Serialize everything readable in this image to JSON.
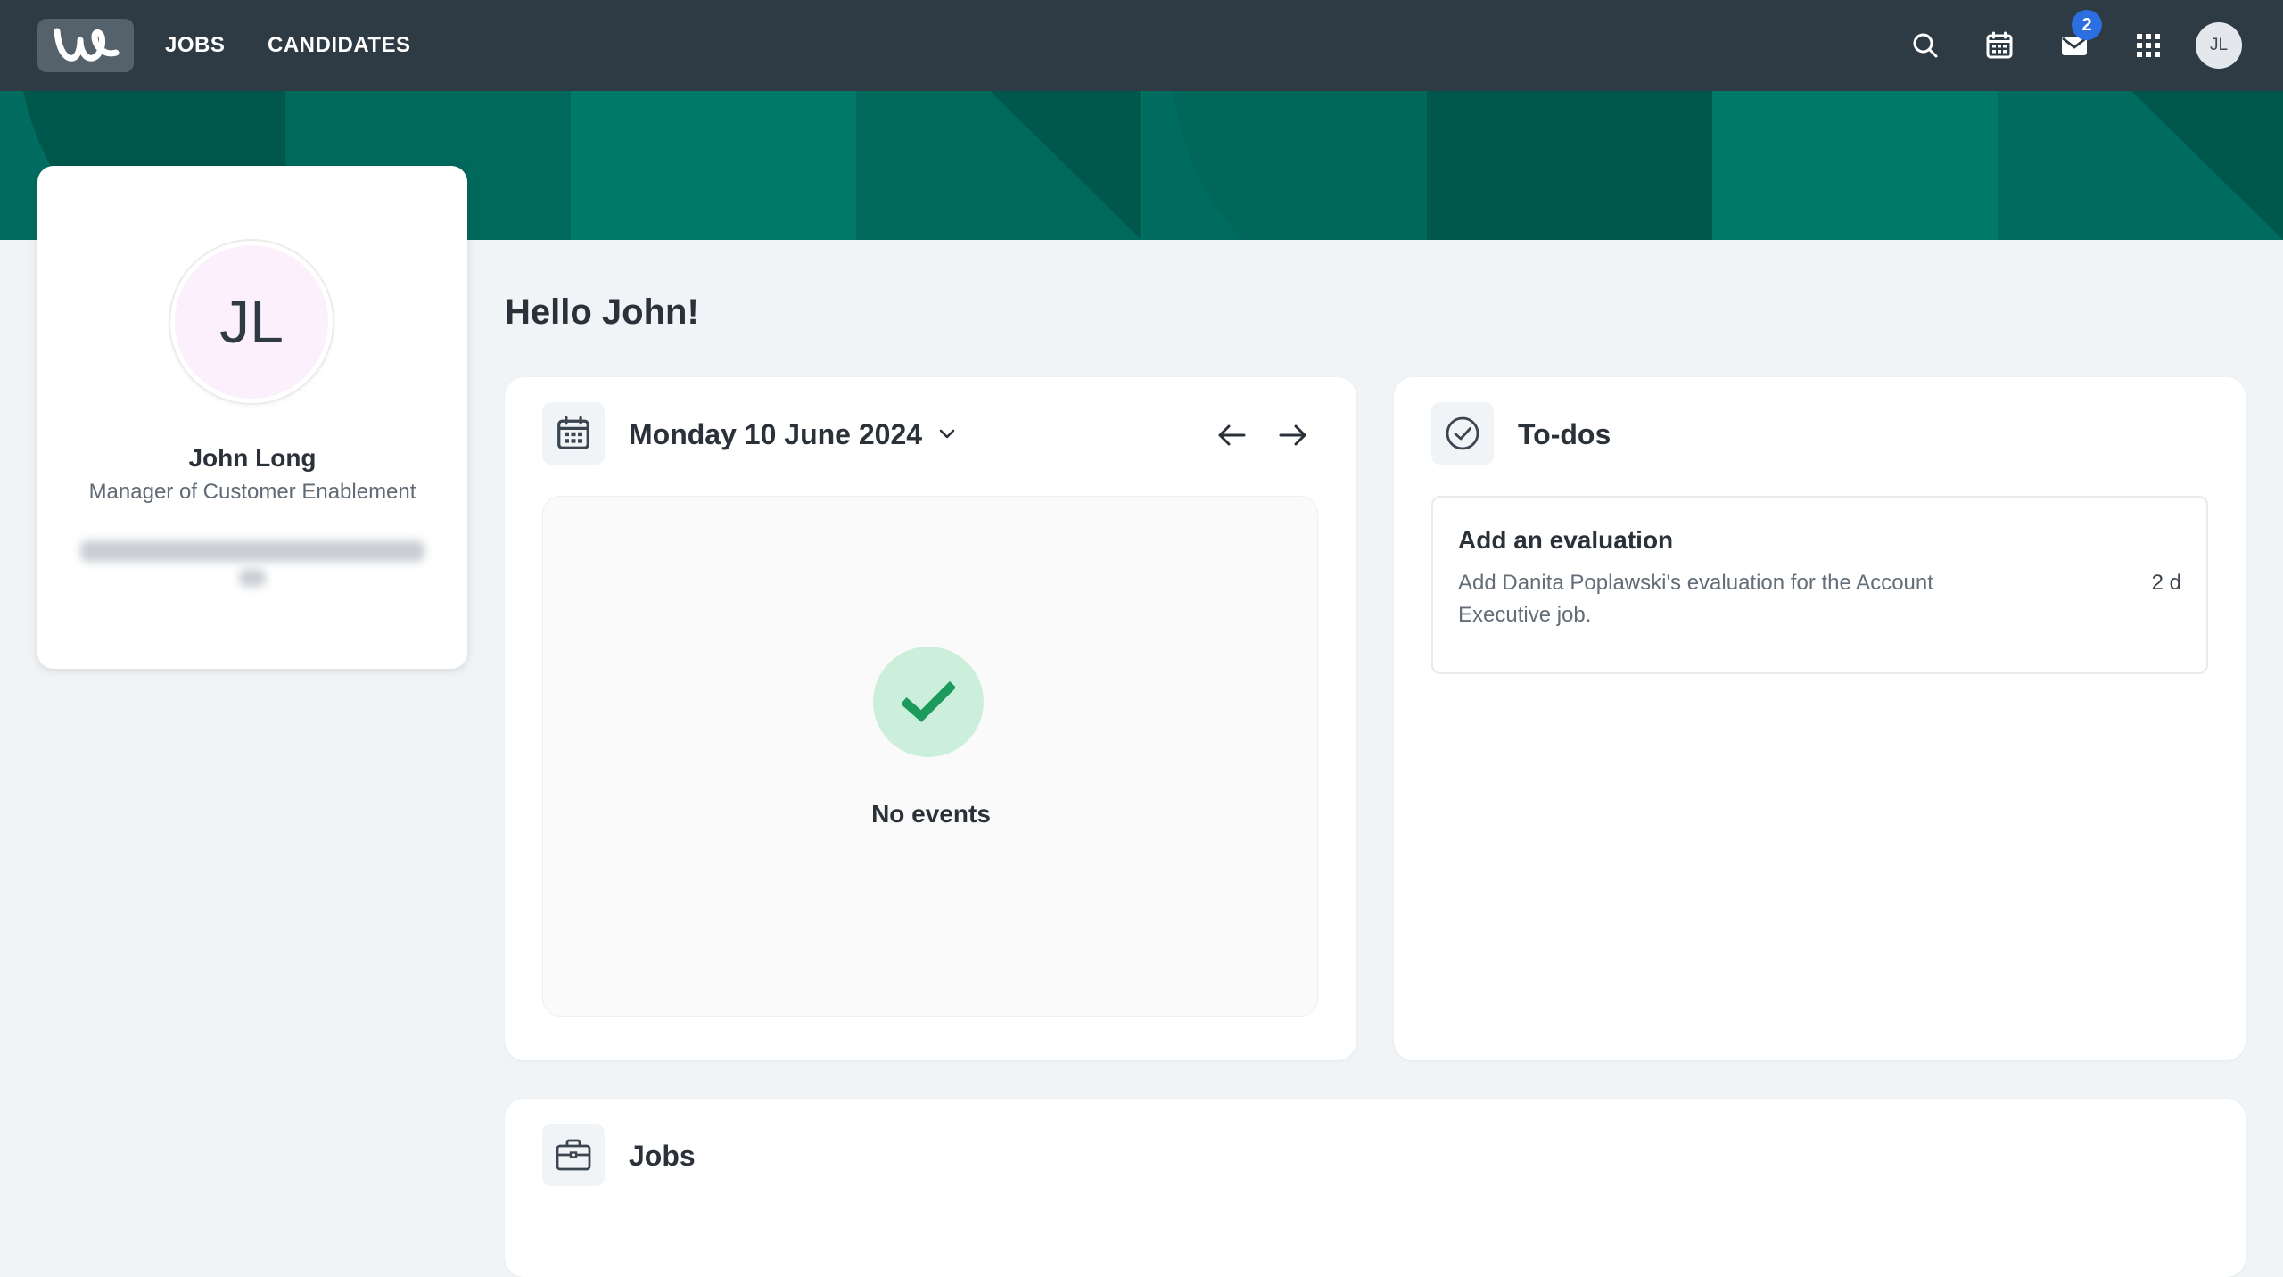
{
  "topbar": {
    "nav": [
      "JOBS",
      "CANDIDATES"
    ],
    "inbox_badge": "2",
    "user_initials": "JL",
    "icons": [
      "search-icon",
      "calendar-icon",
      "inbox-icon",
      "apps-grid-icon"
    ]
  },
  "profile": {
    "initials": "JL",
    "name": "John Long",
    "role": "Manager of Customer Enablement"
  },
  "greeting": "Hello John!",
  "calendar": {
    "date_label": "Monday 10 June 2024",
    "empty_text": "No events"
  },
  "todos": {
    "title": "To-dos",
    "items": [
      {
        "title": "Add an evaluation",
        "description": "Add Danita Poplawski's evaluation for the Account Executive job.",
        "age": "2 d"
      }
    ]
  },
  "jobs": {
    "title": "Jobs"
  },
  "colors": {
    "topbar": "#2e3b45",
    "banner_teal": "#00796b",
    "banner_dark": "#00574b",
    "success_green": "#1b9a5b",
    "badge_blue": "#2b6fe0"
  }
}
